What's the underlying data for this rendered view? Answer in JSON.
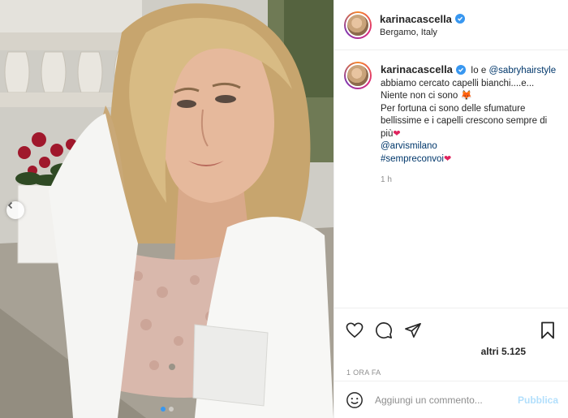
{
  "post": {
    "username": "karinacascella",
    "location": "Bergamo, Italy",
    "caption": {
      "intro": "Io e",
      "mention_1": "@sabryhairstyle",
      "line_1": "abbiamo cercato capelli bianchi....e...",
      "line_2": "Niente non ci sono",
      "line_3": "Per fortuna ci sono delle sfumature bellissime e i capelli crescono sempre di più",
      "mention_2": "@arvismilano",
      "hashtag": "#sempreconvoi",
      "time": "1 h"
    },
    "likes": "altri 5.125",
    "date": "1 ORA FA"
  },
  "comment_box": {
    "placeholder": "Aggiungi un commento...",
    "publish_label": "Pubblica"
  },
  "carousel": {
    "total": 2,
    "active": 1
  },
  "icons": {
    "verified": "verified-badge-icon",
    "prev": "chevron-left-icon",
    "like": "heart-icon",
    "comment": "comment-icon",
    "share": "paper-plane-icon",
    "save": "bookmark-icon",
    "emoji": "smiley-icon",
    "fox_emoji": "fox-emoji-icon",
    "heart_emoji": "red-heart-emoji-icon"
  },
  "colors": {
    "accent": "#3897f0",
    "mention": "#00376b",
    "muted": "#8e8e8e",
    "publish_disabled": "#b2dffc",
    "heart": "#e0245e"
  }
}
